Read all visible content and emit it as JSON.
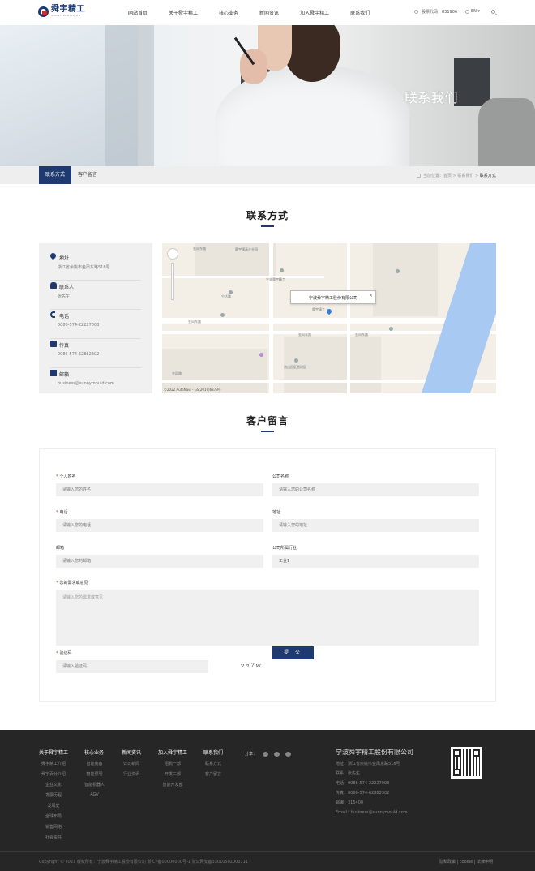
{
  "header": {
    "logo_cn": "舜宇精工",
    "logo_en": "SUNNY PRECISION",
    "nav": [
      "网站首页",
      "关于舜宇精工",
      "核心业务",
      "新闻资讯",
      "加入舜宇精工",
      "联系我们"
    ],
    "hotline": "股票代码：831906",
    "lang": "EN"
  },
  "banner": {
    "title": "联系我们"
  },
  "subnav": {
    "tabs": [
      "联系方式",
      "客户留言"
    ],
    "crumb_prefix": "当前位置：",
    "crumb_home": "首页",
    "crumb_mid": "联系我们",
    "crumb_current": "联系方式"
  },
  "contact_title": "联系方式",
  "contact": [
    {
      "label": "地址",
      "value": "浙江省余姚市金凤东路518号",
      "icon": "location-pin-icon"
    },
    {
      "label": "联系人",
      "value": "张先生",
      "icon": "user-icon"
    },
    {
      "label": "电话",
      "value": "0086-574-22227008",
      "icon": "phone-icon"
    },
    {
      "label": "传真",
      "value": "0086-574-62882302",
      "icon": "fax-icon"
    },
    {
      "label": "邮箱",
      "value": "business@sunnymould.com",
      "icon": "mail-icon"
    }
  ],
  "map": {
    "popup": "宁波舜宇精工股份有限公司",
    "close": "×",
    "labels": [
      "金凤东路",
      "金凤东路",
      "宁波舜宇精工",
      "舜宇模具企业园",
      "宁达路",
      "金凤东路",
      "流山园区首建区",
      "金凤东路",
      "金凤路",
      "舜宇精工"
    ],
    "footer": "©2022 AutoNavi - GS(2019)6379号"
  },
  "form_title": "客户留言",
  "form": {
    "name_label": "个人姓名",
    "name_placeholder": "请输入您的姓名",
    "company_label": "公司名称",
    "company_placeholder": "请输入您的公司名称",
    "phone_label": "电话",
    "phone_placeholder": "请输入您的电话",
    "address_label": "地址",
    "address_placeholder": "请输入您的地址",
    "email_label": "邮箱",
    "email_placeholder": "请输入您的邮箱",
    "industry_label": "公司所属行业",
    "industry_value": "工业1",
    "need_label": "您的需求或意见",
    "need_placeholder": "请输入您的需求或意见",
    "captcha_label": "验证码",
    "captcha_placeholder": "请输入验证码",
    "captcha_text": "va7w",
    "submit": "提 交"
  },
  "footer": {
    "cols": [
      {
        "title": "关于舜宇精工",
        "items": [
          "舜宇精工介绍",
          "舜宇百分介绍",
          "企业文化",
          "发展历程",
          "发展史",
          "全球布局",
          "销售网络",
          "社会责任"
        ]
      },
      {
        "title": "核心业务",
        "items": [
          "智能装备",
          "智能照明",
          "智能机器人",
          "AGV"
        ]
      },
      {
        "title": "新闻资讯",
        "items": [
          "公司新闻",
          "行业资讯"
        ]
      },
      {
        "title": "加入舜宇精工",
        "items": [
          "招聘一部",
          "开发二部",
          "智能开发部"
        ]
      },
      {
        "title": "联系我们",
        "items": [
          "联系方式",
          "客户留言"
        ]
      }
    ],
    "share_label": "分享：",
    "company_name": "宁波舜宇精工股份有限公司",
    "company_lines": [
      "地址：浙江省余姚市金凤东路518号",
      "联系：张先生",
      "电话：0086-574-22227008",
      "传真：0086-574-62882302",
      "邮编：315400",
      "Email：business@sunnymould.com"
    ],
    "copyright": "Copyright © 2021 版权所有：宁波舜宇精工股份有限公司  浙ICP备00000000号-1  浙公网安备33010502003111",
    "links": "隐私政策  |  cookie  |  法律申明"
  }
}
